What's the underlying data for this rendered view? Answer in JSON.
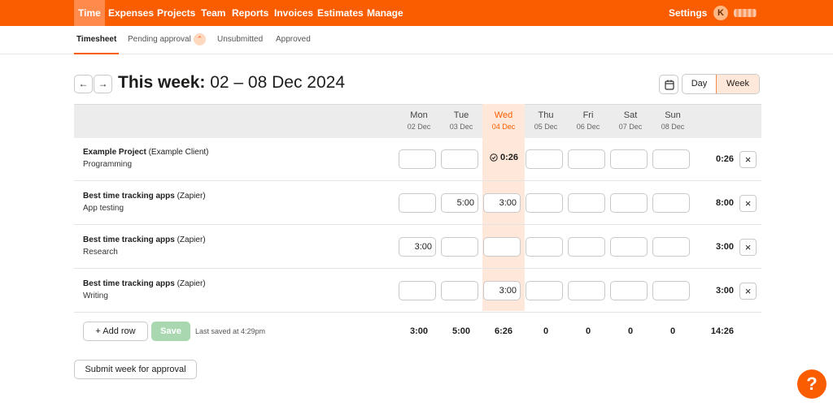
{
  "topnav": {
    "items": [
      "Time",
      "Expenses",
      "Projects",
      "Team",
      "Reports",
      "Invoices",
      "Estimates",
      "Manage"
    ],
    "settings": "Settings",
    "avatar_initial": "K"
  },
  "subnav": {
    "tabs": [
      "Timesheet",
      "Pending approval",
      "Unsubmitted",
      "Approved"
    ]
  },
  "header": {
    "prev": "←",
    "next": "→",
    "title_prefix": "This week:",
    "title_range": "02 – 08 Dec 2024",
    "view_day": "Day",
    "view_week": "Week"
  },
  "days": [
    {
      "name": "Mon",
      "date": "02 Dec"
    },
    {
      "name": "Tue",
      "date": "03 Dec"
    },
    {
      "name": "Wed",
      "date": "04 Dec"
    },
    {
      "name": "Thu",
      "date": "05 Dec"
    },
    {
      "name": "Fri",
      "date": "06 Dec"
    },
    {
      "name": "Sat",
      "date": "07 Dec"
    },
    {
      "name": "Sun",
      "date": "08 Dec"
    }
  ],
  "rows": [
    {
      "project": "Example Project",
      "client": "(Example Client)",
      "task": "Programming",
      "cells": [
        "",
        "",
        "0:26",
        "",
        "",
        "",
        ""
      ],
      "total": "0:26"
    },
    {
      "project": "Best time tracking apps",
      "client": "(Zapier)",
      "task": "App testing",
      "cells": [
        "",
        "5:00",
        "3:00",
        "",
        "",
        "",
        ""
      ],
      "total": "8:00"
    },
    {
      "project": "Best time tracking apps",
      "client": "(Zapier)",
      "task": "Research",
      "cells": [
        "3:00",
        "",
        "",
        "",
        "",
        "",
        ""
      ],
      "total": "3:00"
    },
    {
      "project": "Best time tracking apps",
      "client": "(Zapier)",
      "task": "Writing",
      "cells": [
        "",
        "",
        "3:00",
        "",
        "",
        "",
        ""
      ],
      "total": "3:00"
    }
  ],
  "footer": {
    "add_row": "+ Add row",
    "save": "Save",
    "last_saved": "Last saved at 4:29pm",
    "day_totals": [
      "3:00",
      "5:00",
      "6:26",
      "0",
      "0",
      "0",
      "0"
    ],
    "grand_total": "14:26",
    "submit": "Submit week for approval",
    "help": "?"
  },
  "colors": {
    "brand": "#fa5d00",
    "today_column": "#ffe8d9",
    "save_disabled": "#a9d8b0"
  }
}
